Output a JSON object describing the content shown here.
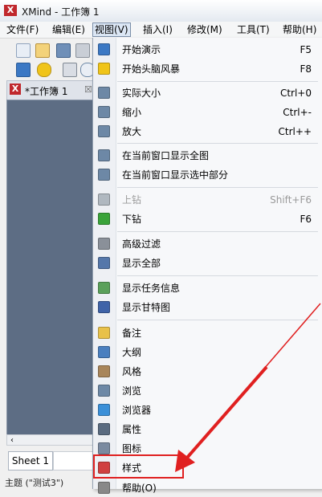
{
  "window": {
    "title": "XMind - 工作簿 1",
    "logo": "X"
  },
  "menubar": {
    "items": [
      {
        "label": "文件(F)"
      },
      {
        "label": "编辑(E)"
      },
      {
        "label": "视图(V)"
      },
      {
        "label": "插入(I)"
      },
      {
        "label": "修改(M)"
      },
      {
        "label": "工具(T)"
      },
      {
        "label": "帮助(H)"
      }
    ]
  },
  "toolbar": {
    "row1_icons": [
      "new-file-icon",
      "open-folder-icon",
      "save-icon",
      "print-icon"
    ],
    "row2_icons": [
      "presentation-icon",
      "brainstorm-icon",
      "export-icon",
      "zoom-icon"
    ]
  },
  "workbook_tab": {
    "label": "*工作簿 1",
    "close": "☒",
    "logo": "X"
  },
  "sheet": {
    "tab_label": "Sheet 1",
    "scroll_arrow": "‹"
  },
  "status": {
    "text": "主题 (\"测试3\")"
  },
  "view_menu": {
    "items": [
      {
        "label": "开始演示",
        "shortcut": "F5",
        "icon": "presentation-icon",
        "color": "#3b78c4"
      },
      {
        "label": "开始头脑风暴",
        "shortcut": "F8",
        "icon": "lightbulb-icon",
        "color": "#f0c419"
      },
      {
        "label": "实际大小",
        "shortcut": "Ctrl+0",
        "icon": "zoom-actual-icon",
        "color": "#6d88a6"
      },
      {
        "label": "缩小",
        "shortcut": "Ctrl+-",
        "icon": "zoom-out-icon",
        "color": "#6d88a6"
      },
      {
        "label": "放大",
        "shortcut": "Ctrl++",
        "icon": "zoom-in-icon",
        "color": "#6d88a6"
      },
      {
        "label": "在当前窗口显示全图",
        "shortcut": "",
        "icon": "fit-map-icon",
        "color": "#6d88a6"
      },
      {
        "label": "在当前窗口显示选中部分",
        "shortcut": "",
        "icon": "fit-selection-icon",
        "color": "#6d88a6"
      },
      {
        "label": "上钻",
        "shortcut": "Shift+F6",
        "icon": "drill-up-icon",
        "color": "#b0b8c0",
        "disabled": true
      },
      {
        "label": "下钻",
        "shortcut": "F6",
        "icon": "drill-down-icon",
        "color": "#3aa33a"
      },
      {
        "label": "高级过滤",
        "shortcut": "",
        "icon": "filter-icon",
        "color": "#8a9099"
      },
      {
        "label": "显示全部",
        "shortcut": "",
        "icon": "show-all-icon",
        "color": "#5577aa"
      },
      {
        "label": "显示任务信息",
        "shortcut": "",
        "icon": "task-info-icon",
        "color": "#5aa05a"
      },
      {
        "label": "显示甘特图",
        "shortcut": "",
        "icon": "gantt-icon",
        "color": "#3f63a8"
      },
      {
        "label": "备注",
        "shortcut": "",
        "icon": "notes-icon",
        "color": "#e8c14a"
      },
      {
        "label": "大纲",
        "shortcut": "",
        "icon": "outline-icon",
        "color": "#4a7fbf"
      },
      {
        "label": "风格",
        "shortcut": "",
        "icon": "style-icon",
        "color": "#a8855a"
      },
      {
        "label": "浏览",
        "shortcut": "",
        "icon": "browse-icon",
        "color": "#6d88a6"
      },
      {
        "label": "浏览器",
        "shortcut": "",
        "icon": "browser-icon",
        "color": "#3a8fd8"
      },
      {
        "label": "属性",
        "shortcut": "",
        "icon": "properties-icon",
        "color": "#5a6b80"
      },
      {
        "label": "图标",
        "shortcut": "",
        "icon": "icons-icon",
        "color": "#7a8aa0"
      },
      {
        "label": "样式",
        "shortcut": "",
        "icon": "styles-icon",
        "color": "#d04040"
      },
      {
        "label": "帮助(O)",
        "shortcut": "",
        "icon": "help-icon",
        "color": "#888888"
      }
    ]
  },
  "colors": {
    "accent": "#e02020",
    "editor_bg": "#5d6d84",
    "menu_bg": "#f7f8fa"
  }
}
